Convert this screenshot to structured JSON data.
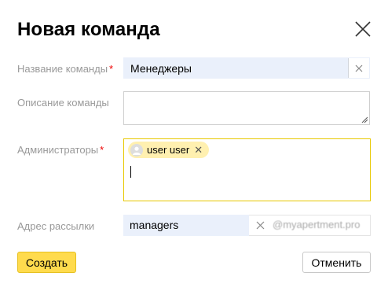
{
  "dialog": {
    "title": "Новая команда"
  },
  "form": {
    "name": {
      "label": "Название команды",
      "required_mark": "*",
      "value": "Менеджеры"
    },
    "description": {
      "label": "Описание команды",
      "value": ""
    },
    "admins": {
      "label": "Администраторы",
      "required_mark": "*",
      "chips": [
        {
          "label": "user user"
        }
      ]
    },
    "mailing": {
      "label": "Адрес рассылки",
      "value": "managers",
      "domain": "@myapertment.pro"
    }
  },
  "actions": {
    "create_label": "Создать",
    "cancel_label": "Отменить"
  },
  "colors": {
    "accent": "#ffdb4d",
    "required": "#ee0000",
    "input_bg": "#eaf0fb",
    "focus_border": "#e8c800"
  }
}
